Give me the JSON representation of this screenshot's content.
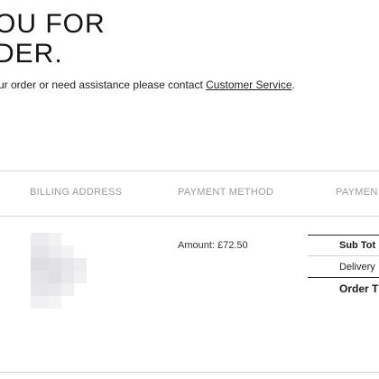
{
  "confirmation": {
    "headline_line1": "OU FOR",
    "headline_line2": "DER.",
    "note_text": "ur order or need assistance please contact ",
    "note_link": "Customer Service",
    "note_end": "."
  },
  "table": {
    "columns": [
      "BILLING ADDRESS",
      "PAYMENT METHOD",
      "PAYMEN"
    ],
    "amount": "Amount: £72.50",
    "totals": {
      "subtotal_label": "Sub Tot",
      "delivery_label": "Delivery",
      "order_total_label": "Order T"
    }
  }
}
